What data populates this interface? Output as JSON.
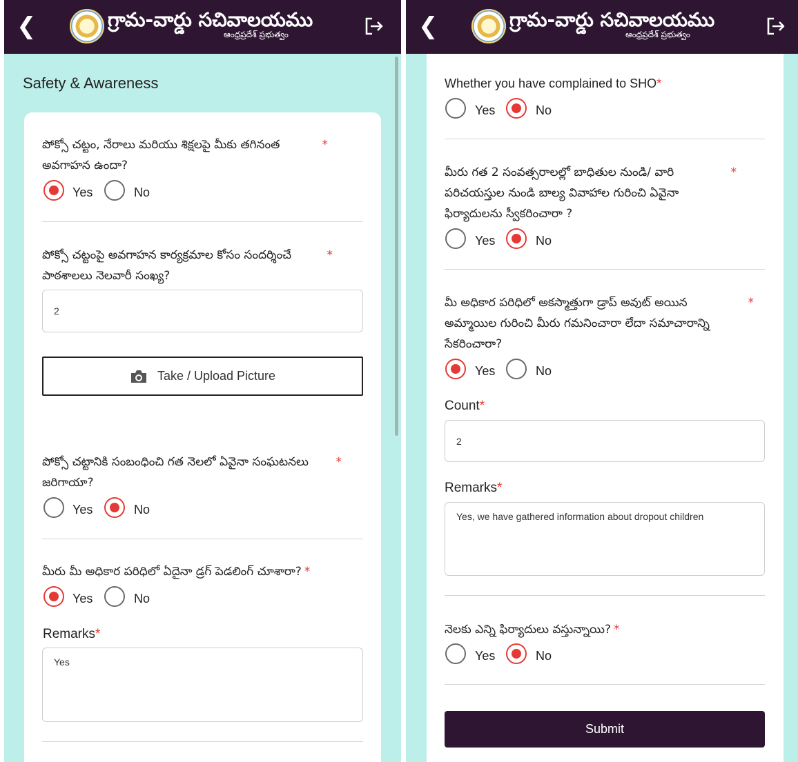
{
  "app": {
    "brand_title": "గ్రామ-వార్డు సచివాలయము",
    "brand_subtitle": "ఆంధ్రప్రదేశ్ ప్రభుత్వం"
  },
  "left": {
    "section_title": "Safety & Awareness",
    "q1": {
      "text": "పోక్సో చట్టం, నేరాలు మరియు శిక్షలపై మీకు తగినంత అవగాహన ఉందా?",
      "yes": "Yes",
      "no": "No",
      "selected": "Yes"
    },
    "q2": {
      "text": "పోక్సో చట్టంపై అవగాహన కార్యక్రమాల కోసం సందర్శించే పాఠశాలలు నెలవారీ సంఖ్య?",
      "value": "2",
      "upload_label": "Take / Upload Picture"
    },
    "q3": {
      "text": "పోక్సో చట్టానికి సంబంధించి గత నెలలో ఏవైనా సంఘటనలు జరిగాయా?",
      "yes": "Yes",
      "no": "No",
      "selected": "No"
    },
    "q4": {
      "text": "మీరు మీ అధికార పరిధిలో ఏదైనా డ్రగ్ పెడలింగ్ చూశారా?",
      "yes": "Yes",
      "no": "No",
      "selected": "Yes",
      "remarks_label": "Remarks",
      "remarks_value": "Yes"
    }
  },
  "right": {
    "q5": {
      "text": "Whether you have complained to SHO",
      "yes": "Yes",
      "no": "No",
      "selected": "No"
    },
    "q6": {
      "text": "మీరు గత 2 సంవత్సరాలల్లో బాధితుల నుండి/ వారి పరిచయస్తుల నుండి బాల్య వివాహాల గురించి ఏవైనా ఫిర్యాదులను స్వీకరించారా ?",
      "yes": "Yes",
      "no": "No",
      "selected": "No"
    },
    "q7": {
      "text": "మీ అధికార పరిధిలో అకస్మాత్తుగా డ్రాప్ అవుట్ అయిన అమ్మాయిల గురించి మీరు గమనించారా లేదా సమాచారాన్ని సేకరించారా?",
      "yes": "Yes",
      "no": "No",
      "selected": "Yes",
      "count_label": "Count",
      "count_value": "2",
      "remarks_label": "Remarks",
      "remarks_value": "Yes, we have gathered information about dropout children"
    },
    "q8": {
      "text": "నెలకు ఎన్ని ఫిర్యాదులు వస్తున్నాయి?",
      "yes": "Yes",
      "no": "No",
      "selected": "No"
    },
    "submit_label": "Submit"
  },
  "icons": {
    "back": "chevron-left-icon",
    "logout": "logout-icon",
    "camera": "camera-icon",
    "logo": "ap-emblem-logo"
  },
  "colors": {
    "appbar": "#2e1633",
    "background": "#bcefe9",
    "accent": "#e53935"
  }
}
